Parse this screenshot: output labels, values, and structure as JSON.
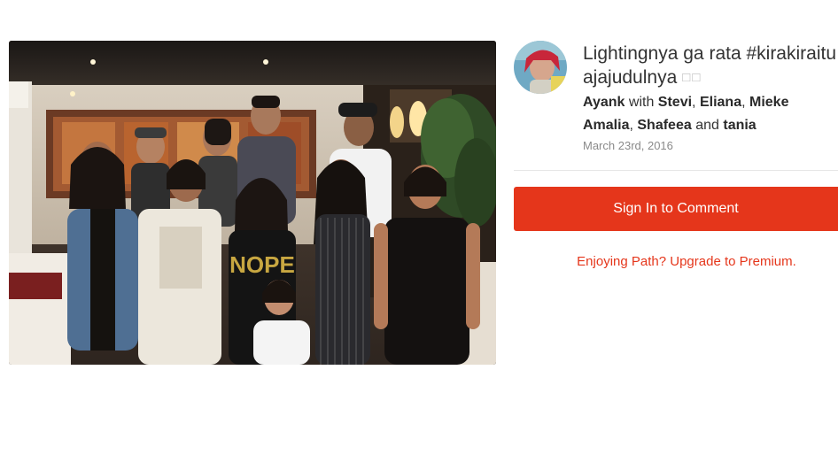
{
  "post": {
    "title_text": "Lightingnya ga rata #kirakiraituajajudulnya",
    "title_extra_glyphs": "□□",
    "author": "Ayank",
    "with_word": "with",
    "tagged": [
      "Stevi",
      "Eliana",
      "Mieke Amalia",
      "Shafeea",
      "tania"
    ],
    "sep_comma": ",",
    "sep_and": "and",
    "date": "March 23rd, 2016",
    "photo_print": "NOPE"
  },
  "actions": {
    "sign_in_label": "Sign In to Comment",
    "upgrade_label": "Enjoying Path? Upgrade to Premium."
  },
  "colors": {
    "accent": "#e5361b",
    "text": "#333333",
    "muted": "#8a8a8a"
  }
}
